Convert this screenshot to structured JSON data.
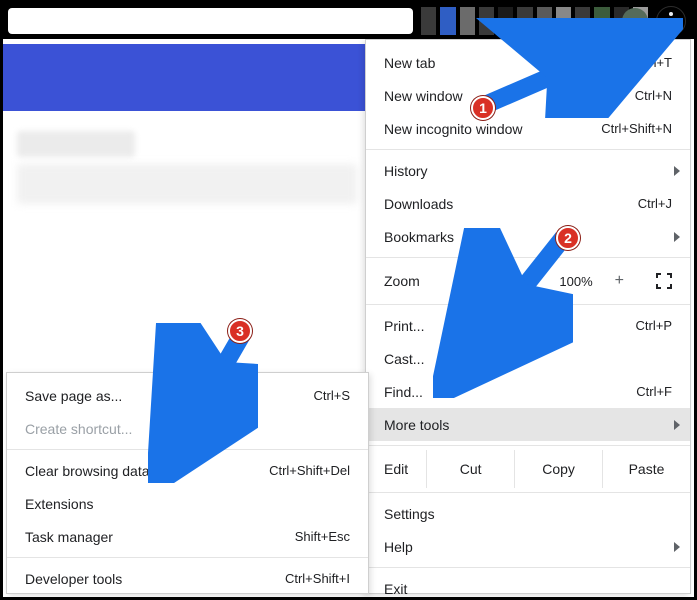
{
  "annotations": {
    "b1": "1",
    "b2": "2",
    "b3": "3"
  },
  "main_menu": {
    "new_tab": "New tab",
    "new_tab_sc": "Ctrl+T",
    "new_window": "New window",
    "new_window_sc": "Ctrl+N",
    "incognito": "New incognito window",
    "incognito_sc": "Ctrl+Shift+N",
    "history": "History",
    "downloads": "Downloads",
    "downloads_sc": "Ctrl+J",
    "bookmarks": "Bookmarks",
    "zoom_label": "Zoom",
    "zoom_value": "100%",
    "print": "Print...",
    "print_sc": "Ctrl+P",
    "cast": "Cast...",
    "find": "Find...",
    "find_sc": "Ctrl+F",
    "more_tools": "More tools",
    "edit": "Edit",
    "cut": "Cut",
    "copy": "Copy",
    "paste": "Paste",
    "settings": "Settings",
    "help": "Help",
    "exit": "Exit"
  },
  "sub_menu": {
    "save_page": "Save page as...",
    "save_page_sc": "Ctrl+S",
    "create_shortcut": "Create shortcut...",
    "clear_browsing": "Clear browsing data...",
    "clear_browsing_sc": "Ctrl+Shift+Del",
    "extensions": "Extensions",
    "task_manager": "Task manager",
    "task_manager_sc": "Shift+Esc",
    "developer_tools": "Developer tools",
    "developer_tools_sc": "Ctrl+Shift+I"
  }
}
